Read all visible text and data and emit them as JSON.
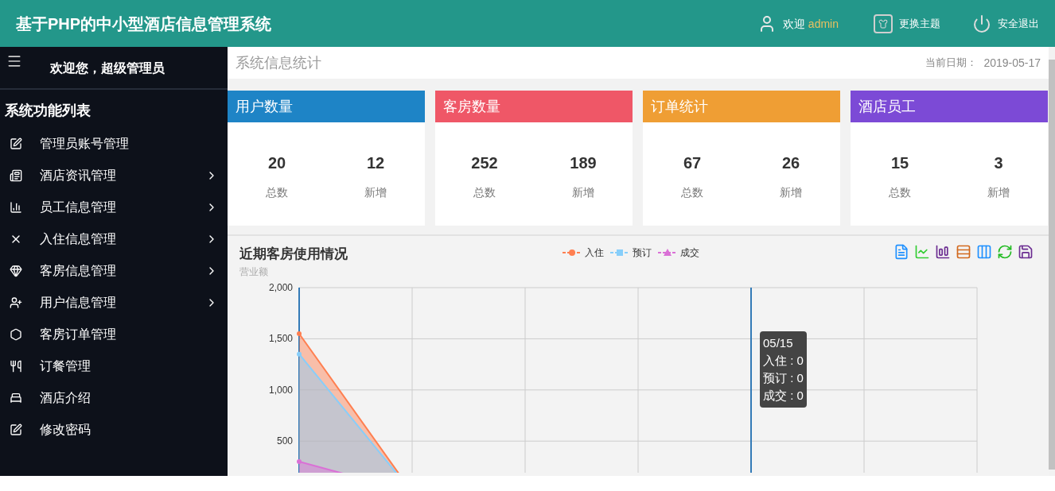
{
  "header": {
    "title": "基于PHP的中小型酒店信息管理系统",
    "welcome": "欢迎",
    "user": "admin",
    "theme": "更换主题",
    "logout": "安全退出"
  },
  "sidebar": {
    "greeting": "欢迎您，超级管理员",
    "heading": "系统功能列表",
    "items": [
      {
        "label": "管理员账号管理",
        "has_submenu": false
      },
      {
        "label": "酒店资讯管理",
        "has_submenu": true
      },
      {
        "label": "员工信息管理",
        "has_submenu": true
      },
      {
        "label": "入住信息管理",
        "has_submenu": true
      },
      {
        "label": "客房信息管理",
        "has_submenu": true
      },
      {
        "label": "用户信息管理",
        "has_submenu": true
      },
      {
        "label": "客房订单管理",
        "has_submenu": false
      },
      {
        "label": "订餐管理",
        "has_submenu": false
      },
      {
        "label": "酒店介绍",
        "has_submenu": false
      },
      {
        "label": "修改密码",
        "has_submenu": false
      }
    ]
  },
  "page": {
    "title": "系统信息统计",
    "date_label": "当前日期：",
    "date": "2019-05-17"
  },
  "cards": [
    {
      "title": "用户数量",
      "color": "#1e84c6",
      "total": "20",
      "total_label": "总数",
      "new": "12",
      "new_label": "新增"
    },
    {
      "title": "客房数量",
      "color": "#ef5767",
      "total": "252",
      "total_label": "总数",
      "new": "189",
      "new_label": "新增"
    },
    {
      "title": "订单统计",
      "color": "#ef9e34",
      "total": "67",
      "total_label": "总数",
      "new": "26",
      "new_label": "新增"
    },
    {
      "title": "酒店员工",
      "color": "#7c4ad6",
      "total": "15",
      "total_label": "总数",
      "new": "3",
      "new_label": "新增"
    }
  ],
  "chart": {
    "title": "近期客房使用情况",
    "tooltip": {
      "title": "05/15",
      "lines": [
        "入住 : 0",
        "预订 : 0",
        "成交 : 0"
      ]
    },
    "chart_data": {
      "type": "area",
      "ylabel": "营业额",
      "ylim": [
        0,
        2000
      ],
      "grid": true,
      "yticks": [
        {
          "value": 500,
          "label": "500"
        },
        {
          "value": 1000,
          "label": "1,000"
        },
        {
          "value": 1500,
          "label": "1,500"
        },
        {
          "value": 2000,
          "label": "2,000"
        }
      ],
      "series": [
        {
          "name": "入住",
          "color": "#ff7f50",
          "values": [
            1550,
            0,
            0,
            0,
            0,
            0,
            0
          ]
        },
        {
          "name": "预订",
          "color": "#87cefa",
          "values": [
            1350,
            0,
            0,
            0,
            0,
            0,
            0
          ]
        },
        {
          "name": "成交",
          "color": "#da70d6",
          "values": [
            300,
            0,
            0,
            0,
            0,
            0,
            0
          ]
        }
      ]
    }
  }
}
